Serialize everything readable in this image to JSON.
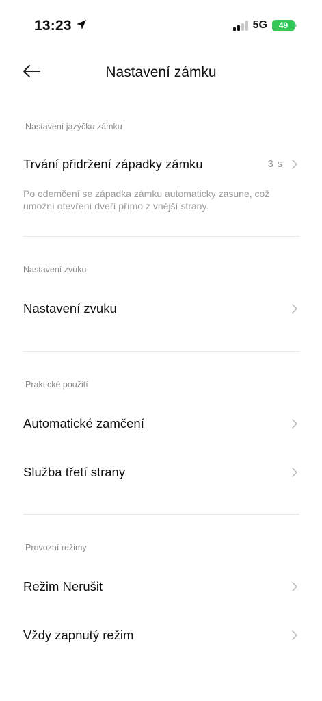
{
  "status_bar": {
    "time": "13:23",
    "network": "5G",
    "battery": "49"
  },
  "header": {
    "title": "Nastavení zámku"
  },
  "sections": [
    {
      "header": "Nastavení jazýčku zámku",
      "items": [
        {
          "label": "Trvání přidržení západky zámku",
          "value": "3 s",
          "description": "Po odemčení se západka zámku automaticky zasune, což umožní otevření dveří přímo z vnější strany."
        }
      ]
    },
    {
      "header": "Nastavení zvuku",
      "items": [
        {
          "label": "Nastavení zvuku"
        }
      ]
    },
    {
      "header": "Praktické použití",
      "items": [
        {
          "label": "Automatické zamčení"
        },
        {
          "label": "Služba třetí strany"
        }
      ]
    },
    {
      "header": "Provozní režimy",
      "items": [
        {
          "label": "Režim Nerušit"
        },
        {
          "label": "Vždy zapnutý režim"
        }
      ]
    }
  ]
}
